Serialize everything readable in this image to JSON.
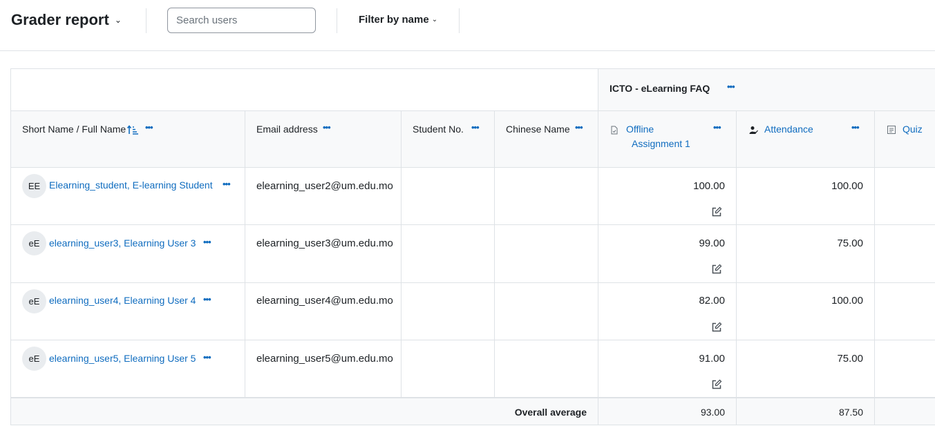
{
  "header": {
    "title": "Grader report",
    "search_placeholder": "Search users",
    "search_value": "",
    "filter_label": "Filter by name"
  },
  "table": {
    "category_label": "ICTO - eLearning FAQ",
    "columns": {
      "name": "Short Name / Full Name",
      "email": "Email address",
      "student_no": "Student No.",
      "chinese_name": "Chinese Name",
      "offline_line1": "Offline",
      "offline_line2": "Assignment 1",
      "attendance": "Attendance",
      "quiz": "Quiz"
    },
    "rows": [
      {
        "initials": "EE",
        "name": "Elearning_student, E-learning Student",
        "email": "elearning_user2@um.edu.mo",
        "offline": "100.00",
        "attendance": "100.00"
      },
      {
        "initials": "eE",
        "name": "elearning_user3, Elearning User 3",
        "email": "elearning_user3@um.edu.mo",
        "offline": "99.00",
        "attendance": "75.00"
      },
      {
        "initials": "eE",
        "name": "elearning_user4, Elearning User 4",
        "email": "elearning_user4@um.edu.mo",
        "offline": "82.00",
        "attendance": "100.00"
      },
      {
        "initials": "eE",
        "name": "elearning_user5, Elearning User 5",
        "email": "elearning_user5@um.edu.mo",
        "offline": "91.00",
        "attendance": "75.00"
      }
    ],
    "average": {
      "label": "Overall average",
      "offline": "93.00",
      "attendance": "87.50"
    }
  },
  "colors": {
    "link": "#0f6cbf",
    "border": "#dee2e6",
    "header_bg": "#f8f9fa"
  },
  "icons": [
    "chevron-down-icon",
    "sort-ascending-icon",
    "more-options-icon",
    "assignment-icon",
    "attendance-icon",
    "quiz-icon",
    "edit-icon"
  ]
}
